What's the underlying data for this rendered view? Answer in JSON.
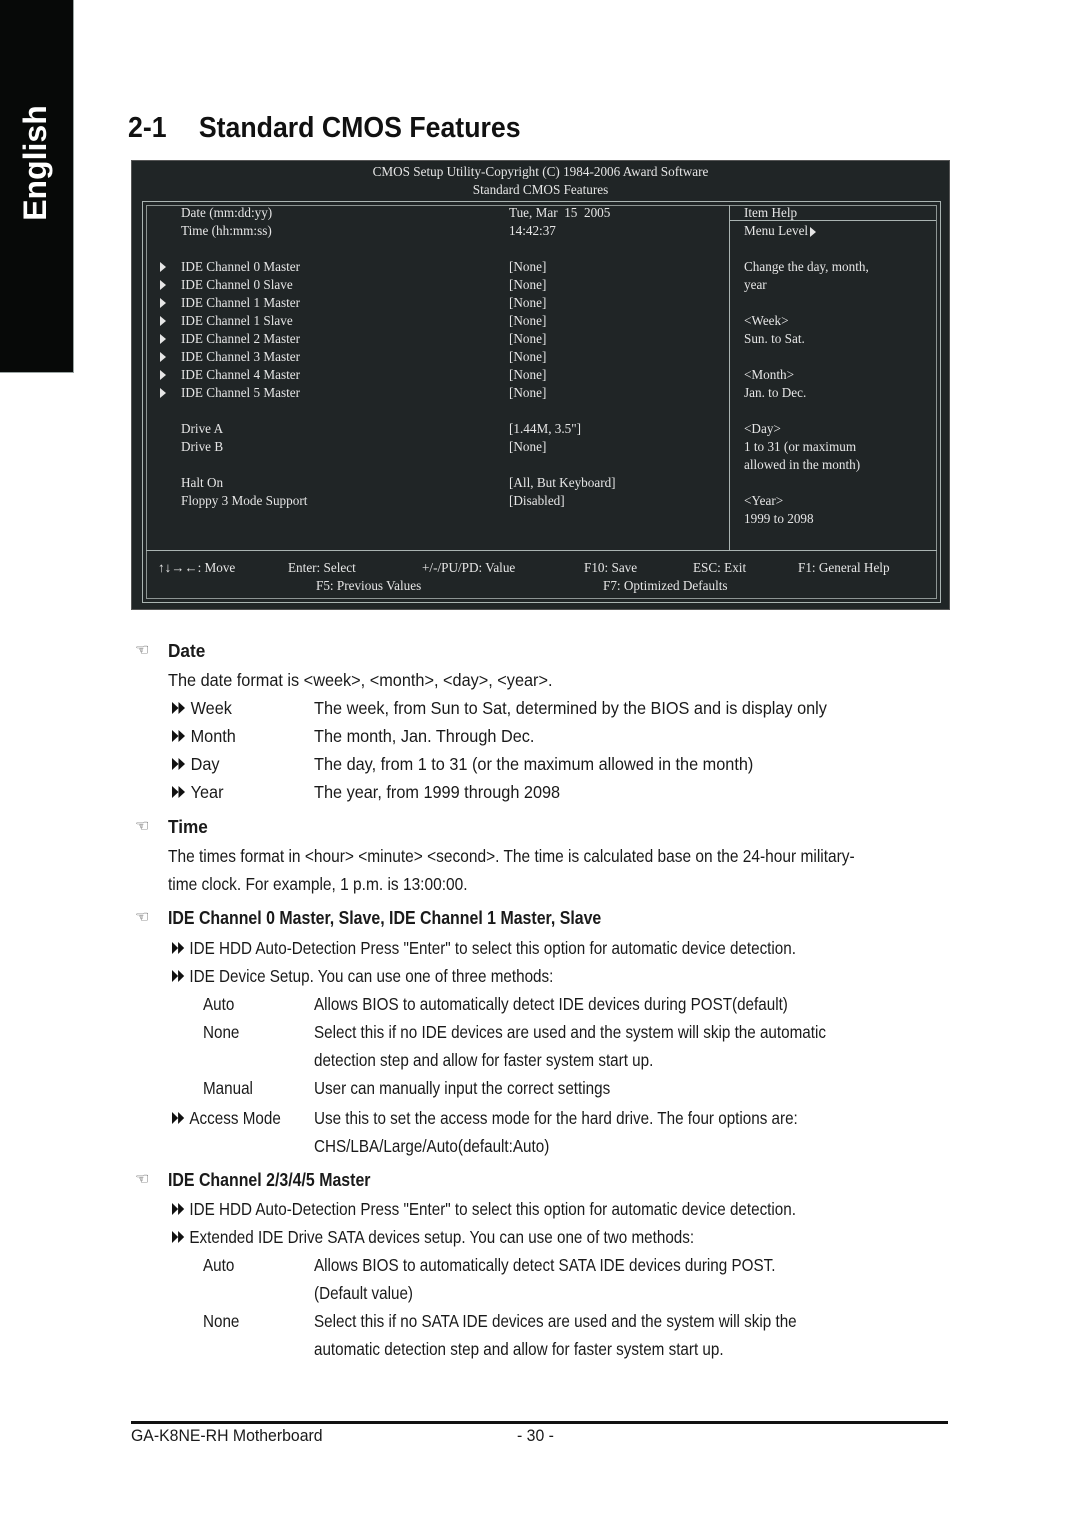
{
  "side_tab": {
    "label": "English"
  },
  "section": {
    "number": "2-1",
    "title": "Standard CMOS Features"
  },
  "bios": {
    "header_line1": "CMOS Setup Utility-Copyright (C) 1984-2006 Award Software",
    "header_line2": "Standard CMOS Features",
    "settings": [
      {
        "label": "Date (mm:dd:yy)",
        "value": "Tue, Mar  15  2005",
        "submenu": false
      },
      {
        "label": "Time (hh:mm:ss)",
        "value": "14:42:37",
        "submenu": false
      },
      {
        "label": "IDE Channel 0 Master",
        "value": "[None]",
        "submenu": true
      },
      {
        "label": "IDE Channel 0 Slave",
        "value": "[None]",
        "submenu": true
      },
      {
        "label": "IDE Channel 1 Master",
        "value": "[None]",
        "submenu": true
      },
      {
        "label": "IDE Channel 1 Slave",
        "value": "[None]",
        "submenu": true
      },
      {
        "label": "IDE Channel 2 Master",
        "value": "[None]",
        "submenu": true
      },
      {
        "label": "IDE Channel 3 Master",
        "value": "[None]",
        "submenu": true
      },
      {
        "label": "IDE Channel 4 Master",
        "value": "[None]",
        "submenu": true
      },
      {
        "label": "IDE Channel 5 Master",
        "value": "[None]",
        "submenu": true
      },
      {
        "label": "Drive A",
        "value": "[1.44M, 3.5\"]",
        "submenu": false
      },
      {
        "label": "Drive B",
        "value": "[None]",
        "submenu": false
      },
      {
        "label": "Halt On",
        "value": "[All, But Keyboard]",
        "submenu": false
      },
      {
        "label": "Floppy 3 Mode Support",
        "value": "[Disabled]",
        "submenu": false
      }
    ],
    "help": {
      "title": "Item Help",
      "menu_level": "Menu Level",
      "lines": [
        "Change the day, month,",
        "year",
        "",
        "<Week>",
        "Sun. to Sat.",
        "",
        "<Month>",
        "Jan. to Dec.",
        "",
        "<Day>",
        "1 to 31 (or maximum",
        "allowed in the month)",
        "",
        "<Year>",
        "1999 to 2098"
      ]
    },
    "keys": {
      "move": "↑↓→←: Move",
      "select": "Enter: Select",
      "value": "+/-/PU/PD: Value",
      "save": "F10: Save",
      "exit": "ESC: Exit",
      "help": "F1: General Help",
      "previous": "F5: Previous Values",
      "defaults": "F7: Optimized Defaults"
    }
  },
  "doc": {
    "date": {
      "heading": "Date",
      "intro": "The date format is <week>, <month>, <day>, <year>.",
      "items": [
        {
          "term": "Week",
          "desc": "The week, from Sun to Sat, determined by the BIOS and is display only"
        },
        {
          "term": "Month",
          "desc": "The month, Jan. Through Dec."
        },
        {
          "term": "Day",
          "desc": "The day, from 1 to 31 (or the maximum allowed in the month)"
        },
        {
          "term": "Year",
          "desc": "The year, from 1999 through 2098"
        }
      ]
    },
    "time": {
      "heading": "Time",
      "line1": "The times format in <hour> <minute> <second>. The time is calculated base on the 24-hour military-",
      "line2": "time clock. For example, 1 p.m. is 13:00:00."
    },
    "ide01": {
      "heading": "IDE Channel 0 Master, Slave, IDE Channel 1 Master, Slave",
      "bullet1": "IDE HDD Auto-Detection  Press \"Enter\" to select this option for automatic device detection.",
      "bullet2": "IDE Device Setup.  You can use one of three methods:",
      "methods": [
        {
          "term": "Auto",
          "lines": [
            "Allows BIOS to automatically detect IDE devices during POST(default)"
          ]
        },
        {
          "term": "None",
          "lines": [
            "Select this if no IDE devices are used and the system will skip the automatic",
            "detection step and allow for faster system start up."
          ]
        },
        {
          "term": "Manual",
          "lines": [
            "User can manually input the correct settings"
          ]
        }
      ],
      "access_term": "Access Mode",
      "access_line1": "Use this to set the access mode for the hard drive. The four options are:",
      "access_line2": "CHS/LBA/Large/Auto(default:Auto)"
    },
    "ide2345": {
      "heading": "IDE Channel 2/3/4/5 Master",
      "bullet1": "IDE HDD Auto-Detection  Press \"Enter\" to select this option for automatic device detection.",
      "bullet2": "Extended IDE Drive SATA devices setup. You can use one of two methods:",
      "methods": [
        {
          "term": "Auto",
          "lines": [
            "Allows BIOS to automatically detect SATA IDE devices during POST.",
            "(Default value)"
          ]
        },
        {
          "term": "None",
          "lines": [
            "Select this if no SATA IDE devices are used and the system will skip the",
            "automatic detection step and allow for faster system start up."
          ]
        }
      ]
    }
  },
  "footer": {
    "product": "GA-K8NE-RH Motherboard",
    "page": "- 30 -"
  }
}
